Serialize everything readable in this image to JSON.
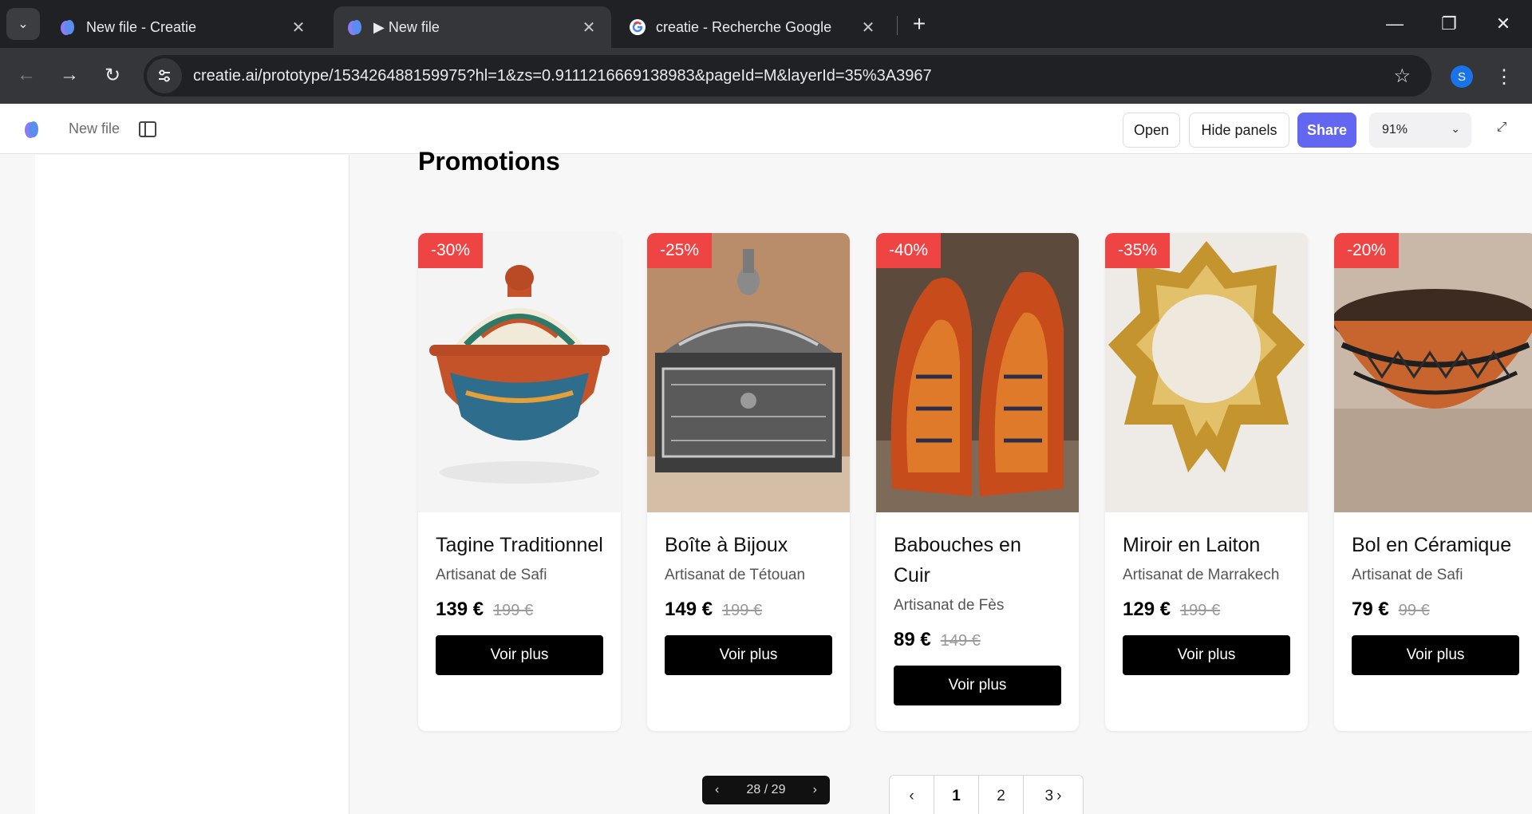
{
  "browser": {
    "tabs": [
      {
        "title": "New file - Creatie",
        "close": "✕"
      },
      {
        "title": "▶ New file",
        "close": "✕"
      },
      {
        "title": "creatie - Recherche Google",
        "close": "✕"
      }
    ],
    "new_tab": "+",
    "url": "creatie.ai/prototype/153426488159975?hl=1&zs=0.9111216669138983&pageId=M&layerId=35%3A3967",
    "profile_initial": "S",
    "window_controls": {
      "minimize": "—",
      "restore": "❐",
      "close": "✕"
    }
  },
  "app": {
    "file_name": "New file",
    "buttons": {
      "open": "Open",
      "hide_panels": "Hide panels",
      "share": "Share"
    },
    "zoom": "91%"
  },
  "page": {
    "heading": "Promotions",
    "products": [
      {
        "badge": "-30%",
        "name": "Tagine Traditionnel",
        "origin": "Artisanat de Safi",
        "price": "139 €",
        "old_price": "199 €",
        "cta": "Voir plus",
        "image": "tagine"
      },
      {
        "badge": "-25%",
        "name": "Boîte à Bijoux",
        "origin": "Artisanat de Tétouan",
        "price": "149 €",
        "old_price": "199 €",
        "cta": "Voir plus",
        "image": "jewelry-box"
      },
      {
        "badge": "-40%",
        "name": "Babouches en Cuir",
        "origin": "Artisanat de Fès",
        "price": "89 €",
        "old_price": "149 €",
        "cta": "Voir plus",
        "image": "babouches"
      },
      {
        "badge": "-35%",
        "name": "Miroir en Laiton",
        "origin": "Artisanat de Marrakech",
        "price": "129 €",
        "old_price": "199 €",
        "cta": "Voir plus",
        "image": "mirror"
      },
      {
        "badge": "-20%",
        "name": "Bol en Céramique",
        "origin": "Artisanat de Safi",
        "price": "79 €",
        "old_price": "99 €",
        "cta": "Voir plus",
        "image": "bowl"
      }
    ],
    "prototype_pager": "28 / 29",
    "pagination": {
      "pages": [
        "1",
        "2",
        "3"
      ],
      "active": "1"
    }
  }
}
